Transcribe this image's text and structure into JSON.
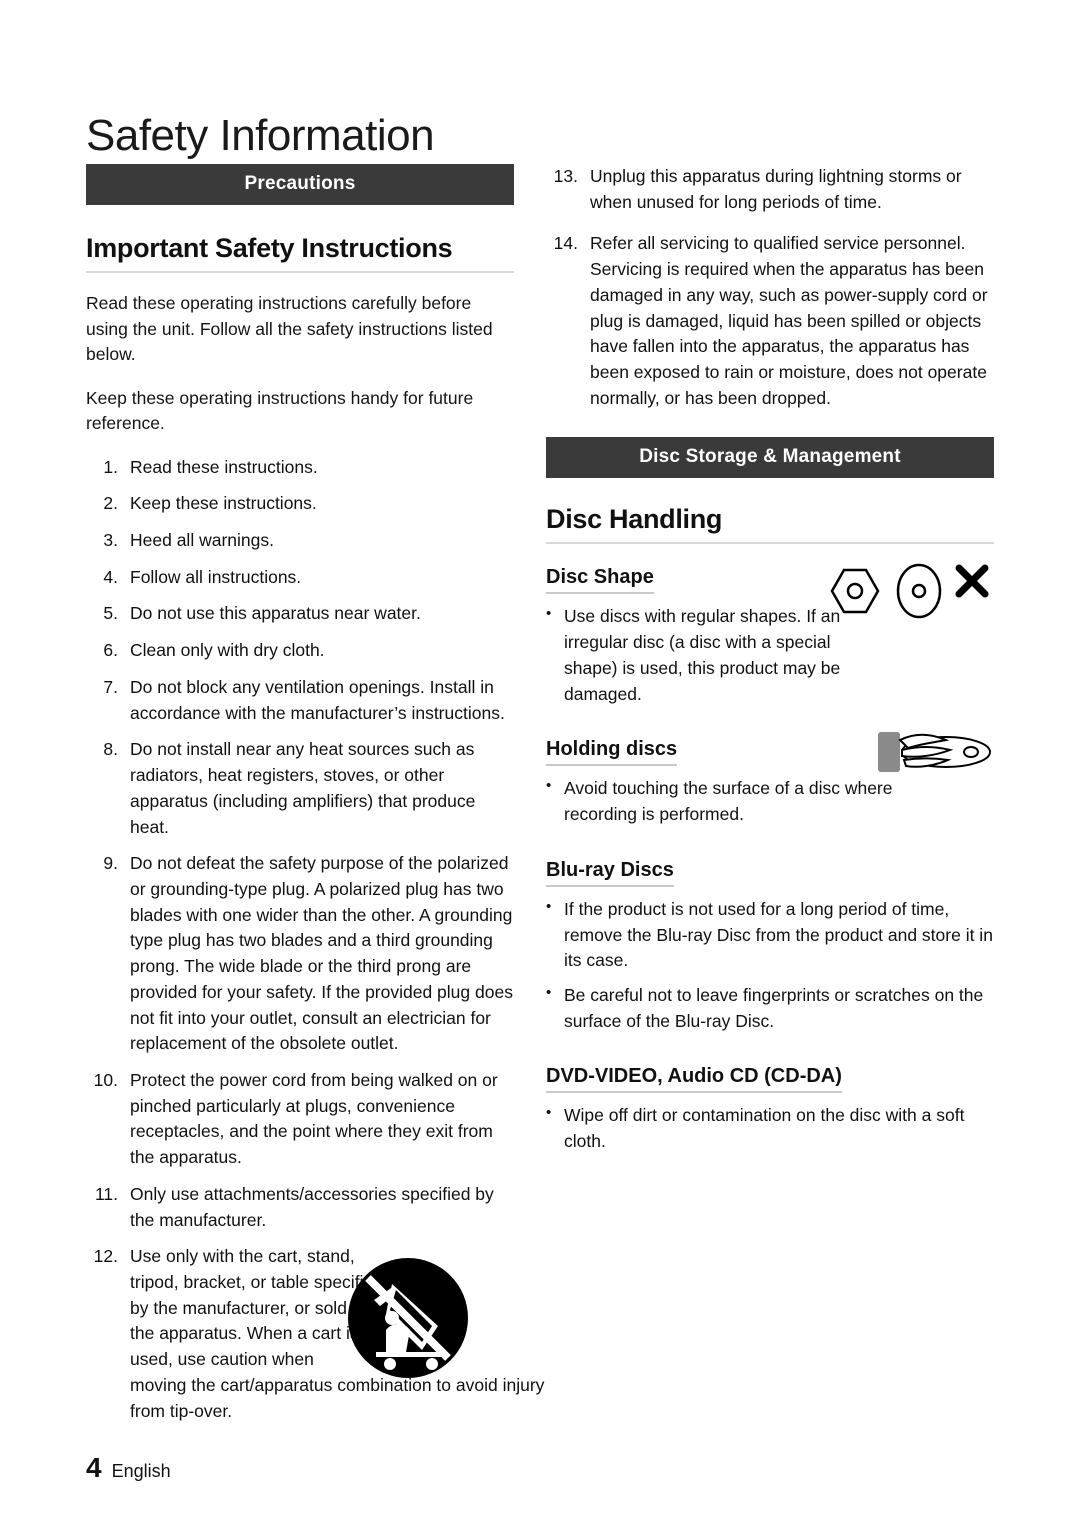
{
  "page": {
    "title": "Safety Information",
    "footer": {
      "number": "4",
      "language": "English"
    }
  },
  "left": {
    "section_bar": "Precautions",
    "heading": "Important Safety Instructions",
    "intro_1": "Read these operating instructions carefully before using the unit. Follow all the safety instructions listed below.",
    "intro_2": "Keep these operating instructions handy for future reference.",
    "items": [
      {
        "num": "1.",
        "text": "Read these instructions."
      },
      {
        "num": "2.",
        "text": "Keep these instructions."
      },
      {
        "num": "3.",
        "text": "Heed all warnings."
      },
      {
        "num": "4.",
        "text": "Follow all instructions."
      },
      {
        "num": "5.",
        "text": "Do not use this apparatus near water."
      },
      {
        "num": "6.",
        "text": "Clean only with dry cloth."
      },
      {
        "num": "7.",
        "text": "Do not block any ventilation openings. Install in accordance with the manufacturer’s instructions."
      },
      {
        "num": "8.",
        "text": "Do not install near any heat sources such as radiators, heat registers, stoves, or other apparatus (including amplifiers) that produce heat."
      },
      {
        "num": "9.",
        "text": "Do not defeat the safety purpose of the polarized or grounding-type plug. A polarized plug has two blades with one wider than the other. A grounding type plug has two blades and a third grounding prong. The wide blade or the third prong are provided for your safety. If the provided plug does not fit into your outlet, consult an electrician for replacement of the obsolete outlet."
      },
      {
        "num": "10.",
        "text": "Protect the power cord from being walked on or pinched particularly at plugs, convenience receptacles, and the point where they exit from the apparatus."
      },
      {
        "num": "11.",
        "text": "Only use attachments/accessories specified by the manufacturer."
      }
    ],
    "item12": {
      "num": "12.",
      "text_wrapped": "Use only with the cart, stand, tripod, bracket, or table specified by the manufacturer, or sold with the apparatus. When a cart is used, use caution when",
      "text_full": "moving the cart/apparatus combination to avoid injury from tip-over.",
      "icon": "cart-tipover-warning-icon"
    }
  },
  "right": {
    "items": [
      {
        "num": "13.",
        "text": "Unplug this apparatus during lightning storms or when unused for long periods of time."
      },
      {
        "num": "14.",
        "text": "Refer all servicing to qualified service personnel. Servicing is required when the apparatus has been damaged in any way, such as power-supply cord or plug is damaged, liquid has been spilled or objects have fallen into the apparatus, the apparatus has been exposed to rain or moisture, does not operate normally, or has been dropped."
      }
    ],
    "section_bar": "Disc Storage & Management",
    "heading": "Disc Handling",
    "disc_shape": {
      "title": "Disc Shape",
      "bullet": "Use discs with regular shapes. If an irregular disc (a disc with a special shape) is used, this product may be damaged.",
      "icons": [
        "hexagon-disc-icon",
        "oval-disc-icon",
        "cross-mark-icon"
      ]
    },
    "holding_discs": {
      "title": "Holding discs",
      "bullet": "Avoid touching the surface of a disc where recording is performed.",
      "icon": "hand-holding-disc-icon"
    },
    "bluray_discs": {
      "title": "Blu-ray Discs",
      "bullets": [
        "If the product is not used for a long period of time, remove the Blu-ray Disc from the product and store it in its case.",
        "Be careful not to leave fingerprints or scratches on the surface of the Blu-ray Disc."
      ]
    },
    "dvd_video": {
      "title": "DVD-VIDEO, Audio CD (CD-DA)",
      "bullets": [
        "Wipe off dirt or contamination on the disc with a soft cloth."
      ]
    }
  },
  "colors": {
    "bar_background": "#3a3a3a",
    "bar_text": "#ffffff",
    "body_text": "#141414",
    "rule": "#d8d8d8"
  }
}
